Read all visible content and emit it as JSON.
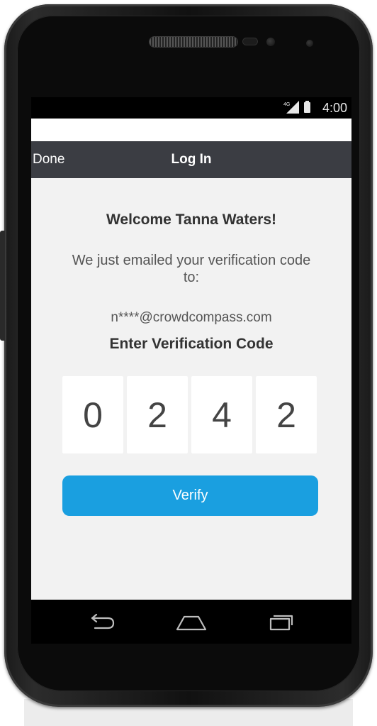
{
  "status_bar": {
    "network": "4G",
    "time": "4:00",
    "icons": [
      "signal-icon",
      "battery-icon"
    ]
  },
  "nav_bar": {
    "left_action": "Done",
    "title": "Log In"
  },
  "login": {
    "welcome": "Welcome Tanna Waters!",
    "message": "We just emailed your verification code to:",
    "email": "n****@crowdcompass.com",
    "enter_label": "Enter Verification Code",
    "code_digits": [
      "0",
      "2",
      "4",
      "2"
    ],
    "verify_label": "Verify"
  },
  "system_nav": {
    "icons": [
      "back-icon",
      "home-icon",
      "recents-icon"
    ]
  },
  "colors": {
    "navbar": "#3b3d43",
    "accent": "#1a9fe0",
    "screen_bg": "#f2f2f2"
  }
}
